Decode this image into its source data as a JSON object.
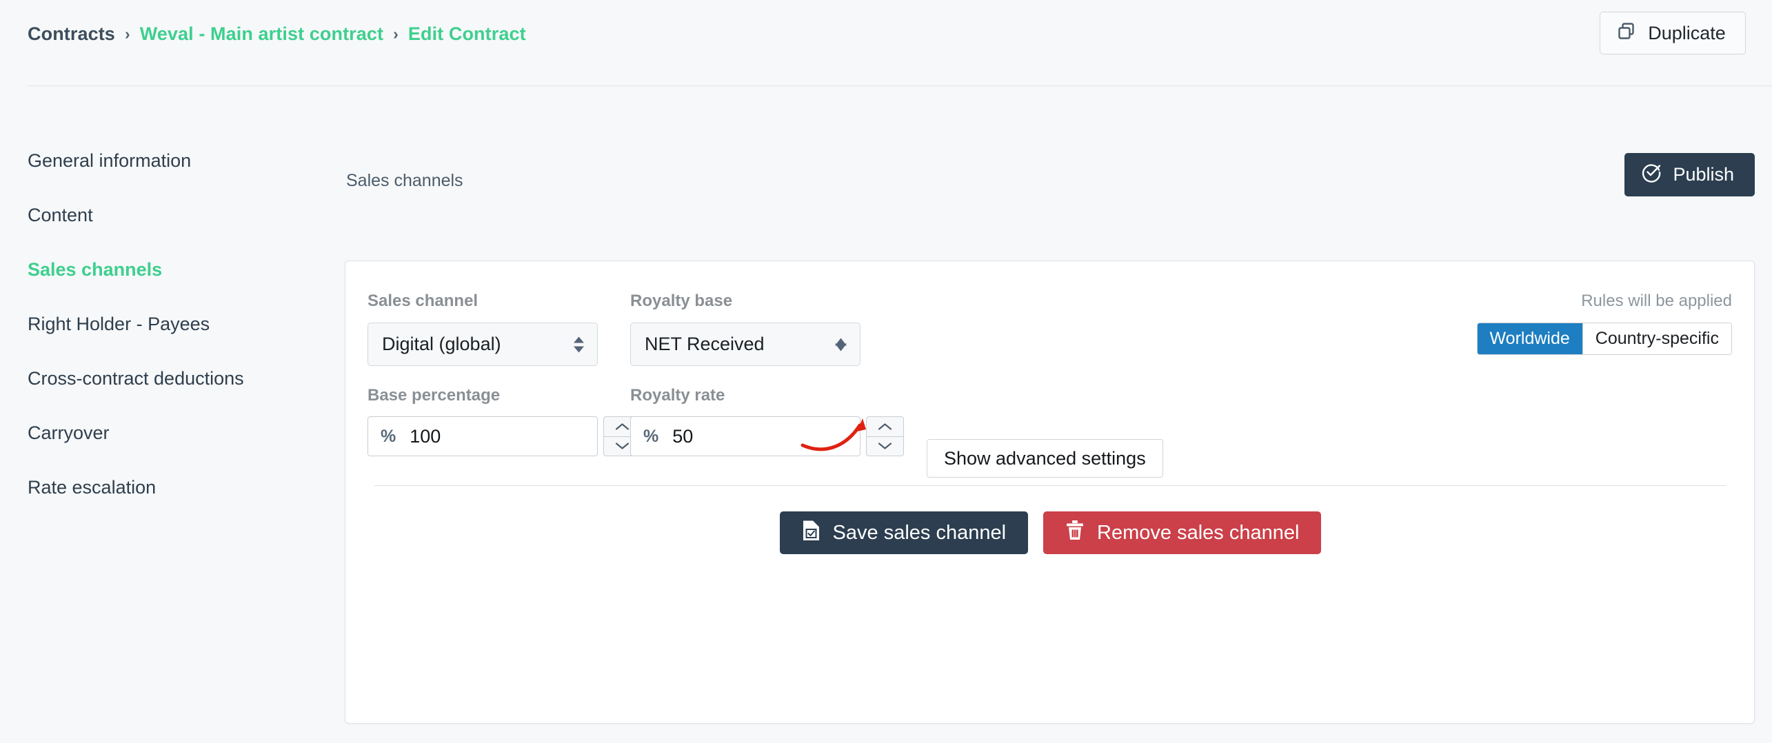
{
  "topbar": {
    "breadcrumb": {
      "root": "Contracts",
      "sep1": "›",
      "contract": "Weval - Main artist contract",
      "sep2": "›",
      "current": "Edit Contract"
    },
    "duplicate_label": "Duplicate",
    "duplicate_icon": "copy-icon"
  },
  "sidebar": {
    "items": [
      {
        "label": "General information",
        "active": false
      },
      {
        "label": "Content",
        "active": false
      },
      {
        "label": "Sales channels",
        "active": true
      },
      {
        "label": "Right Holder - Payees",
        "active": false
      },
      {
        "label": "Cross-contract deductions",
        "active": false
      },
      {
        "label": "Carryover",
        "active": false
      },
      {
        "label": "Rate escalation",
        "active": false
      }
    ]
  },
  "main": {
    "section_title": "Sales channels",
    "publish_label": "Publish",
    "publish_icon": "check-circle-icon"
  },
  "card": {
    "sales_channel": {
      "label": "Sales channel",
      "value": "Digital (global)"
    },
    "royalty_base": {
      "label": "Royalty base",
      "value": "NET Received"
    },
    "base_percentage": {
      "label": "Base percentage",
      "prefix": "%",
      "value": "100"
    },
    "royalty_rate": {
      "label": "Royalty rate",
      "prefix": "%",
      "value": "50"
    },
    "rules": {
      "caption": "Rules will be applied",
      "options": [
        {
          "label": "Worldwide",
          "active": true
        },
        {
          "label": "Country-specific",
          "active": false
        }
      ]
    },
    "advanced_label": "Show advanced settings",
    "actions": {
      "save_label": "Save sales channel",
      "save_icon": "document-check-icon",
      "remove_label": "Remove sales channel",
      "remove_icon": "trash-icon"
    }
  },
  "annotation": {
    "shape": "curved-arrow",
    "color": "#e02111",
    "points_to": "royalty-rate-input"
  },
  "colors": {
    "accent_green": "#3ecf8e",
    "dark_navy": "#2c3e50",
    "toggle_blue": "#1d7ec1",
    "danger_red": "#cb4049",
    "page_bg": "#f6f8f9"
  }
}
